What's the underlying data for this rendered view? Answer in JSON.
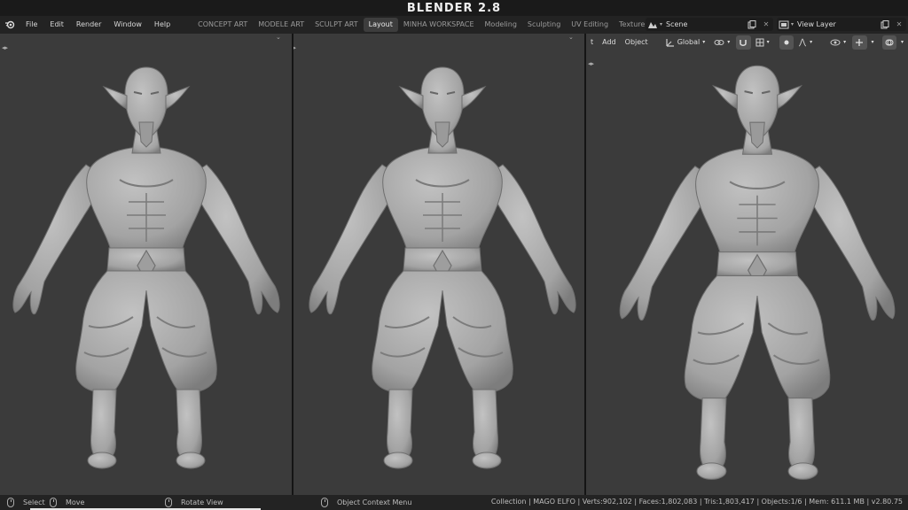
{
  "title": "BLENDER 2.8",
  "menu": [
    "File",
    "Edit",
    "Render",
    "Window",
    "Help"
  ],
  "workspaces": [
    "CONCEPT ART",
    "MODELE ART",
    "SCULPT ART",
    "Layout",
    "MINHA WORKSPACE",
    "Modeling",
    "Sculpting",
    "UV Editing",
    "Texture Pair"
  ],
  "active_workspace": "Layout",
  "scene": {
    "name": "Scene",
    "view_layer": "View Layer"
  },
  "viewport_header": {
    "mode_stub": "t",
    "add": "Add",
    "object": "Object",
    "orientation": "Global"
  },
  "status": {
    "select": "Select",
    "move": "Move",
    "rotate_view": "Rotate View",
    "context_menu": "Object Context Menu",
    "stats": "Collection | MAGO ELFO | Verts:902,102 | Faces:1,802,083 | Tris:1,803,417 | Objects:1/6 | Mem: 611.1 MB | v2.80.75"
  },
  "colors": {
    "viewport_bg": "#3b3b3b",
    "mesh": "#a8a8a8",
    "topbar": "#232323",
    "active_tab": "#3d3d3d"
  }
}
